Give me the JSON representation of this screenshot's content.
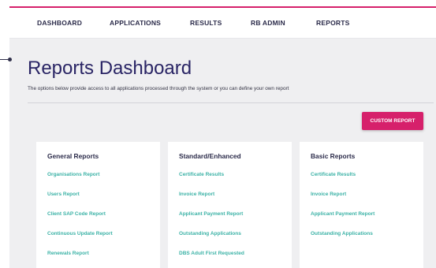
{
  "nav": {
    "items": [
      {
        "label": "DASHBOARD"
      },
      {
        "label": "APPLICATIONS"
      },
      {
        "label": "RESULTS"
      },
      {
        "label": "RB ADMIN"
      },
      {
        "label": "REPORTS"
      }
    ]
  },
  "page": {
    "title": "Reports Dashboard",
    "description": "The options below provide access to all applications processed through the system or you can define your own report"
  },
  "actions": {
    "custom_report_label": "CUSTOM REPORT"
  },
  "cards": [
    {
      "title": "General Reports",
      "links": [
        "Organisations Report",
        "Users Report",
        "Client SAP Code Report",
        "Continuous Update Report",
        "Renewals Report"
      ]
    },
    {
      "title": "Standard/Enhanced",
      "links": [
        "Certificate Results",
        "Invoice Report",
        "Applicant Payment Report",
        "Outstanding Applications",
        "DBS Adult First Requested"
      ]
    },
    {
      "title": "Basic Reports",
      "links": [
        "Certificate Results",
        "Invoice Report",
        "Applicant Payment Report",
        "Outstanding Applications"
      ]
    }
  ],
  "colors": {
    "accent": "#d6206b",
    "link": "#3bb2a6",
    "title": "#2a2565",
    "background": "#efeff1"
  }
}
